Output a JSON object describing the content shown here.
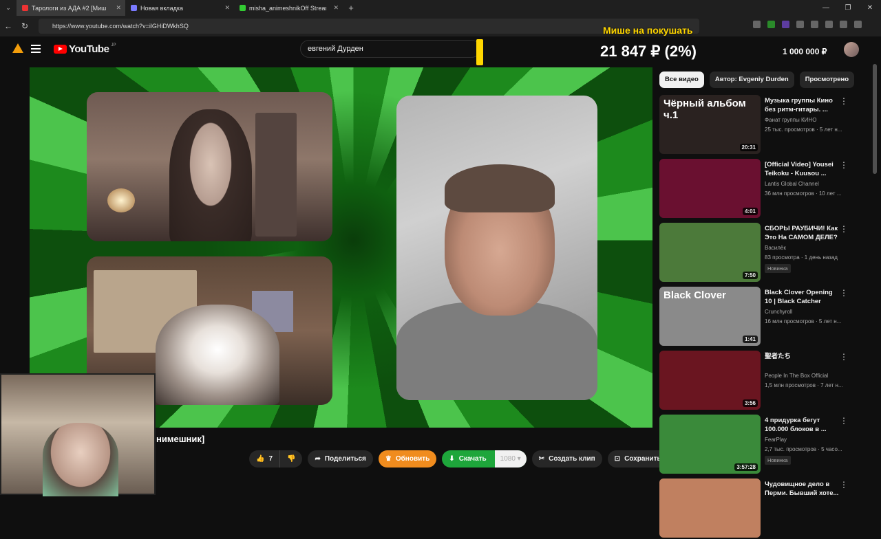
{
  "browser": {
    "tabs": [
      {
        "title": "Тарологи из АДА #2 [Миш",
        "color": "#e33"
      },
      {
        "title": "Новая вкладка",
        "color": "#7a7aff"
      },
      {
        "title": "misha_animeshnikOff Stream - W",
        "color": "#3c3"
      }
    ],
    "url": "https://www.youtube.com/watch?v=ilGHiDWkhSQ"
  },
  "youtube": {
    "logo_text": "YouTube",
    "region": "JP",
    "search_value": "евгений Дурден"
  },
  "donation": {
    "title": "Мише на покушать",
    "amount": "21 847 ₽ (2%)",
    "goal": "1 000 000 ₽",
    "progress_fraction": 0.02
  },
  "video": {
    "channel_fragment": "нимешник]",
    "like_count": "7",
    "share_label": "Поделиться",
    "upgrade_label": "Обновить",
    "download_label": "Скачать",
    "quality_label": "1080",
    "clip_label": "Создать клип",
    "save_label": "Сохранить"
  },
  "chips": [
    "Все видео",
    "Автор: Evgeniy Durden",
    "Просмотрено"
  ],
  "sidebar": [
    {
      "title": "Музыка группы Кино без ритм-гитары. ...",
      "channel": "Фанат группы КИНО",
      "meta": "25 тыс. просмотров · 5 лет н...",
      "duration": "20:31",
      "thumb_text": "Чёрный альбом ч.1",
      "bg": "#2a2220"
    },
    {
      "title": "[Official Video] Yousei Teikoku - Kuusou ...",
      "channel": "Lantis Global Channel",
      "meta": "36 млн просмотров · 10 лет ...",
      "duration": "4:01",
      "bg": "#6a1030"
    },
    {
      "title": "СБОРЫ РАУБИЧИ! Как Это На САМОМ ДЕЛЕ?",
      "channel": "Василёк",
      "meta": "83 просмотра · 1 день назад",
      "badge": "Новинка",
      "duration": "7:50",
      "bg": "#4c7a3a"
    },
    {
      "title": "Black Clover Opening 10 | Black Catcher",
      "channel": "Crunchyroll",
      "meta": "16 млн просмотров · 5 лет н...",
      "duration": "1:41",
      "thumb_text": "Black Clover",
      "bg": "#8a8a8a"
    },
    {
      "title": "聖者たち",
      "channel": "People In The Box Official",
      "meta": "1,5 млн просмотров · 7 лет н...",
      "duration": "3:56",
      "bg": "#6a1520"
    },
    {
      "title": "4 придурка бегут 100.000 блоков в ...",
      "channel": "FearPlay",
      "meta": "2,7 тыс. просмотров · 5 часо...",
      "badge": "Новинка",
      "duration": "3:57:28",
      "bg": "#3a8a3a"
    },
    {
      "title": "Чудовищное дело в Перми. Бывший хоте...",
      "channel": "",
      "meta": "",
      "duration": "",
      "bg": "#c08060"
    }
  ]
}
